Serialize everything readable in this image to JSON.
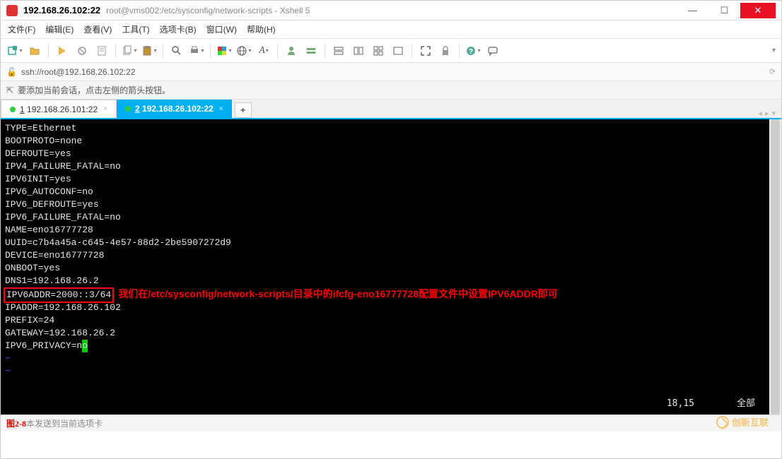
{
  "window": {
    "title_main": "192.168.26.102:22",
    "title_sub": "root@vms002:/etc/sysconfig/network-scripts - Xshell 5"
  },
  "menu": {
    "file": "文件(F)",
    "edit": "编辑(E)",
    "view": "查看(V)",
    "tools": "工具(T)",
    "tab": "选项卡(B)",
    "window": "窗口(W)",
    "help": "帮助(H)"
  },
  "address": {
    "url": "ssh://root@192.168.26.102:22"
  },
  "infobar": {
    "text": "要添加当前会话，点击左侧的箭头按钮。"
  },
  "tabs": {
    "items": [
      {
        "index": "1",
        "label": "192.168.26.101:22",
        "active": false
      },
      {
        "index": "2",
        "label": "192.168.26.102:22",
        "active": true
      }
    ]
  },
  "terminal": {
    "lines": [
      "TYPE=Ethernet",
      "BOOTPROTO=none",
      "DEFROUTE=yes",
      "IPV4_FAILURE_FATAL=no",
      "IPV6INIT=yes",
      "IPV6_AUTOCONF=no",
      "IPV6_DEFROUTE=yes",
      "IPV6_FAILURE_FATAL=no",
      "NAME=eno16777728",
      "UUID=c7b4a45a-c645-4e57-88d2-2be5907272d9",
      "DEVICE=eno16777728",
      "ONBOOT=yes",
      "DNS1=192.168.26.2"
    ],
    "highlighted_line": "IPV6ADDR=2000::3/64",
    "annotation": "我们在/etc/sysconfig/network-scripts/目录中的ifcfg-eno16777728配置文件中设置IPV6ADDR即可",
    "lines_after": [
      "IPADDR=192.168.26.102",
      "PREFIX=24",
      "GATEWAY=192.168.26.2"
    ],
    "last_line_pre": "IPV6_PRIVACY=n",
    "last_line_cursor": "o",
    "status_pos": "18,15",
    "status_mode": "全部"
  },
  "statusbar": {
    "figure": "图2-8",
    "text": "本发送到当前选项卡"
  },
  "watermark": "创新互联"
}
